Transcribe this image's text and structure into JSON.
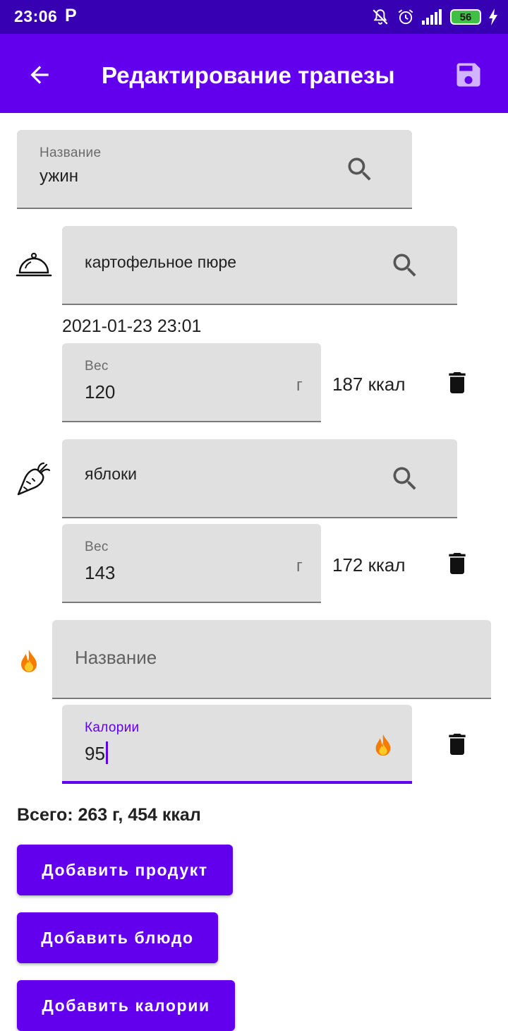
{
  "status_bar": {
    "time": "23:06",
    "app_indicator": "P",
    "battery_level": "56",
    "icons": [
      "muted-icon",
      "alarm-icon",
      "signal-icon",
      "battery-icon",
      "charging-icon"
    ]
  },
  "app_bar": {
    "title": "Редактирование трапезы",
    "back_icon": "arrow-back-icon",
    "save_icon": "save-icon"
  },
  "meal_name": {
    "label": "Название",
    "value": "ужин",
    "icon": "search-icon"
  },
  "items": [
    {
      "type_icon": "dish-cloche-icon",
      "name": "картофельное пюре",
      "date": "2021-01-23 23:01",
      "weight_label": "Вес",
      "weight": "120",
      "unit": "г",
      "kcal": "187 ккал"
    },
    {
      "type_icon": "carrot-icon",
      "name": "яблоки",
      "weight_label": "Вес",
      "weight": "143",
      "unit": "г",
      "kcal": "172 ккал"
    },
    {
      "type_icon": "fire-icon",
      "name_placeholder": "Название",
      "calories_label": "Калории",
      "calories": "95"
    }
  ],
  "total": "Всего: 263 г, 454 ккал",
  "buttons": {
    "add_product": "Добавить продукт",
    "add_dish": "Добавить блюдо",
    "add_calories": "Добавить калории"
  },
  "colors": {
    "primary": "#6200ee",
    "primary_dark": "#3700b3",
    "field_bg": "#e0e0e0"
  }
}
